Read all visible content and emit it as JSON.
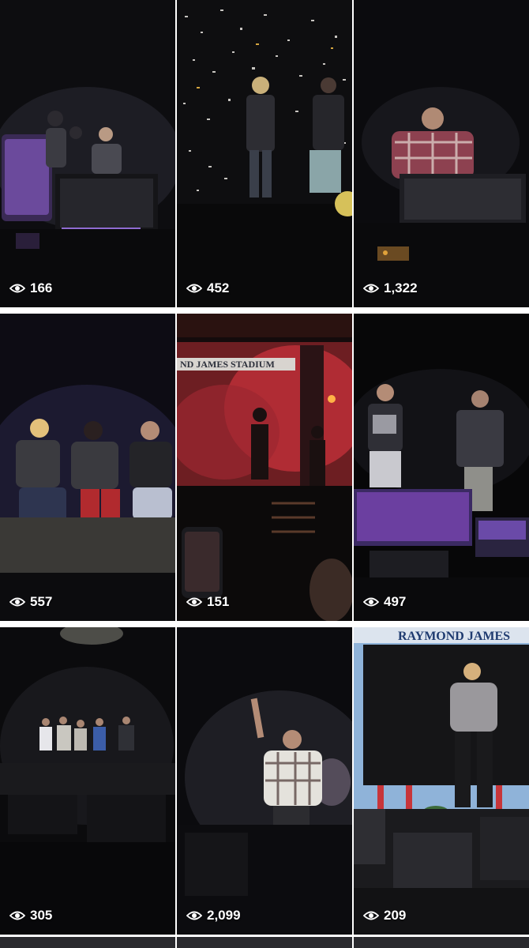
{
  "gallery": {
    "tiles": [
      {
        "views": "166",
        "scene": "stage-lounge-purple-chairs",
        "icon": "eye-icon"
      },
      {
        "views": "452",
        "scene": "confetti-duo-stage",
        "icon": "eye-icon"
      },
      {
        "views": "1,322",
        "scene": "plaid-singer-monitor",
        "icon": "eye-icon"
      },
      {
        "views": "557",
        "scene": "trio-seated-bench",
        "icon": "eye-icon"
      },
      {
        "views": "151",
        "scene": "red-smoke-stadium-sign",
        "icon": "eye-icon"
      },
      {
        "views": "497",
        "scene": "duo-purple-monitors",
        "icon": "eye-icon"
      },
      {
        "views": "305",
        "scene": "group-dark-stage",
        "icon": "eye-icon"
      },
      {
        "views": "2,099",
        "scene": "plaid-jacket-peace-sign",
        "icon": "eye-icon"
      },
      {
        "views": "209",
        "scene": "daylight-stadium-performer",
        "icon": "eye-icon"
      }
    ],
    "stadium_signs": {
      "tile5": "ND JAMES STADIUM",
      "tile9": "RAYMOND JAMES"
    }
  },
  "colors": {
    "overlay_text": "#ffffff",
    "stage_purple": "#6b3fa0",
    "smoke_red": "#c0303a",
    "sky_blue": "#8fb3d9"
  }
}
